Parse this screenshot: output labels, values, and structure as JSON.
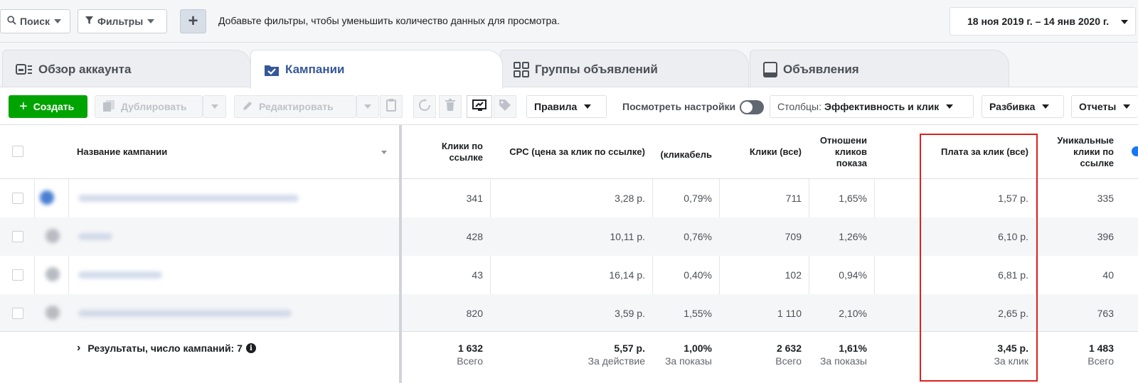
{
  "filterbar": {
    "search_label": "Поиск",
    "filters_label": "Фильтры",
    "add_label": "+",
    "hint": "Добавьте фильтры, чтобы уменьшить количество данных для просмотра.",
    "date_range": "18 ноя 2019 г. – 14 янв 2020 г."
  },
  "tabs": [
    {
      "label": "Обзор аккаунта",
      "icon": "account-overview-icon"
    },
    {
      "label": "Кампании",
      "icon": "campaigns-icon",
      "active": true
    },
    {
      "label": "Группы объявлений",
      "icon": "ad-sets-icon"
    },
    {
      "label": "Объявления",
      "icon": "ads-icon"
    }
  ],
  "toolbar": {
    "create": "Создать",
    "duplicate": "Дублировать",
    "edit": "Редактировать",
    "rules": "Правила",
    "view_settings": "Посмотреть настройки",
    "columns_prefix": "Столбцы:",
    "columns_value": "Эффективность и клик",
    "breakdown": "Разбивка",
    "reports": "Отчеты"
  },
  "table": {
    "headers": {
      "name": "Название кампании",
      "link_clicks": "Клики по ссылке",
      "cpc_link": "CPC (цена за клик по ссылке)",
      "ctr": "(кликабель",
      "clicks_all": "Клики (все)",
      "ratio": "Отношени кликов показа",
      "cpc_all": "Плата за клик (все)",
      "unique_clicks": "Уникальные клики по ссылке"
    },
    "rows": [
      {
        "link_clicks": "341",
        "cpc_link": "3,28 р.",
        "ctr": "0,79%",
        "clicks_all": "711",
        "ratio": "1,65%",
        "cpc_all": "1,57 р.",
        "unique_clicks": "335"
      },
      {
        "link_clicks": "428",
        "cpc_link": "10,11 р.",
        "ctr": "0,76%",
        "clicks_all": "709",
        "ratio": "1,26%",
        "cpc_all": "6,10 р.",
        "unique_clicks": "396"
      },
      {
        "link_clicks": "43",
        "cpc_link": "16,14 р.",
        "ctr": "0,40%",
        "clicks_all": "102",
        "ratio": "0,94%",
        "cpc_all": "6,81 р.",
        "unique_clicks": "40"
      },
      {
        "link_clicks": "820",
        "cpc_link": "3,59 р.",
        "ctr": "1,55%",
        "clicks_all": "1 110",
        "ratio": "2,10%",
        "cpc_all": "2,65 р.",
        "unique_clicks": "763"
      }
    ],
    "totals": {
      "label": "Результаты, число кампаний: 7",
      "link_clicks": {
        "value": "1 632",
        "sub": "Всего"
      },
      "cpc_link": {
        "value": "5,57 р.",
        "sub": "За действие"
      },
      "ctr": {
        "value": "1,00%",
        "sub": "За показы"
      },
      "clicks_all": {
        "value": "2 632",
        "sub": "Всего"
      },
      "ratio": {
        "value": "1,61%",
        "sub": "За показы"
      },
      "cpc_all": {
        "value": "3,45 р.",
        "sub": "За клик"
      },
      "unique_clicks": {
        "value": "1 483",
        "sub": "Всего"
      }
    }
  },
  "colors": {
    "accent": "#365899",
    "create_green": "#00a400",
    "highlight_red": "#e0201b"
  }
}
